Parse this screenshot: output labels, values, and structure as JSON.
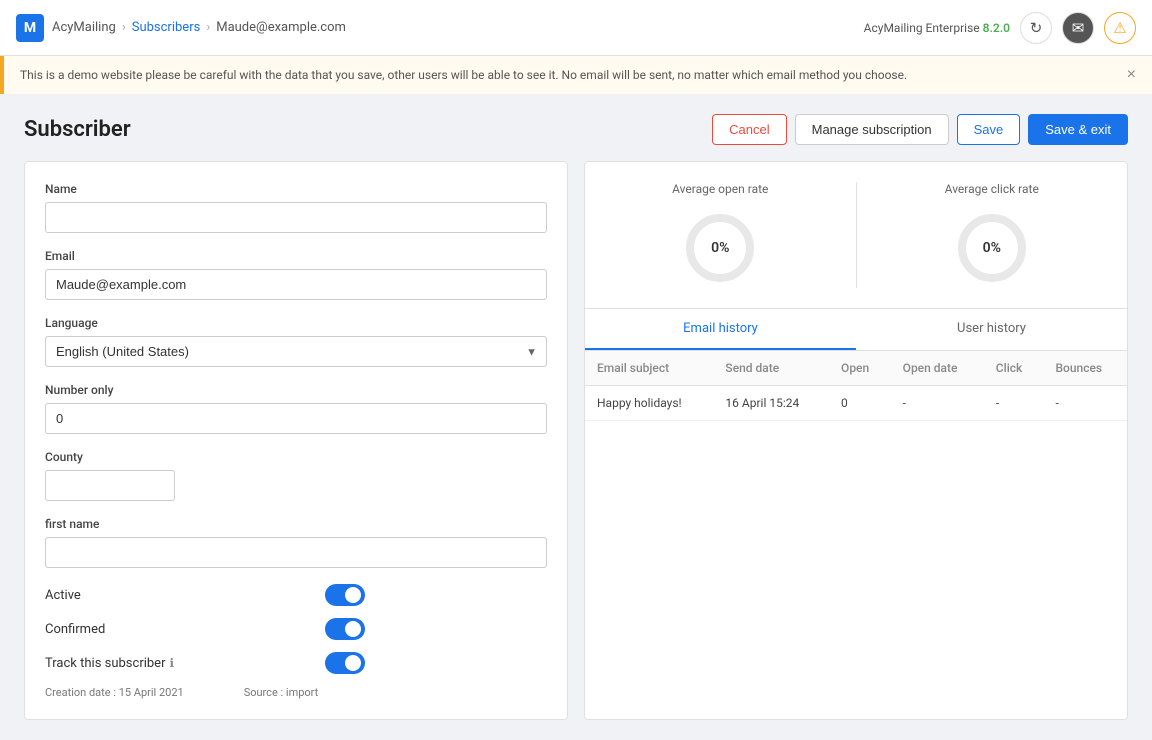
{
  "header": {
    "logo_letter": "M",
    "app_name": "AcyMailing",
    "breadcrumb": [
      "AcyMailing",
      "Subscribers",
      "Maude@example.com"
    ],
    "version_label": "AcyMailing Enterprise",
    "version_number": "8.2.0",
    "icons": [
      "refresh-icon",
      "email-icon",
      "warning-icon"
    ]
  },
  "alert": {
    "text": "This is a demo website please be careful with the data that you save, other users will be able to see it. No email will be sent, no matter which email method you choose.",
    "close_label": "×"
  },
  "page": {
    "title": "Subscriber",
    "buttons": {
      "cancel": "Cancel",
      "manage_subscription": "Manage subscription",
      "save": "Save",
      "save_exit": "Save & exit"
    }
  },
  "form": {
    "name_label": "Name",
    "name_value": "",
    "email_label": "Email",
    "email_value": "Maude@example.com",
    "language_label": "Language",
    "language_value": "English (United States)",
    "number_only_label": "Number only",
    "number_only_value": "0",
    "county_label": "County",
    "county_value": "",
    "first_name_label": "first name",
    "first_name_value": "",
    "active_label": "Active",
    "confirmed_label": "Confirmed",
    "track_label": "Track this subscriber",
    "creation_label": "Creation date :",
    "creation_value": "15 April 2021",
    "source_label": "Source :",
    "source_value": "import"
  },
  "stats": {
    "open_rate_label": "Average open rate",
    "open_rate_value": "0%",
    "click_rate_label": "Average click rate",
    "click_rate_value": "0%"
  },
  "tabs": {
    "email_history": "Email history",
    "user_history": "User history"
  },
  "history_table": {
    "columns": [
      "Email subject",
      "Send date",
      "Open",
      "Open date",
      "Click",
      "Bounces"
    ],
    "rows": [
      {
        "subject": "Happy holidays!",
        "send_date": "16 April 15:24",
        "open": "0",
        "open_date": "-",
        "click": "-",
        "bounces": "-"
      }
    ]
  }
}
